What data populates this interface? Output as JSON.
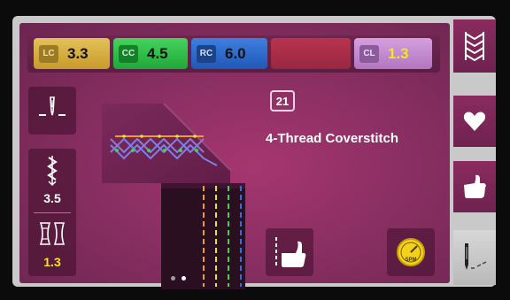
{
  "tension": {
    "lc": {
      "tag": "LC",
      "value": "3.3"
    },
    "cc": {
      "tag": "CC",
      "value": "4.5"
    },
    "rc": {
      "tag": "RC",
      "value": "6.0"
    },
    "cl": {
      "tag": "CL",
      "value": "1.3"
    }
  },
  "stitch": {
    "number": "21",
    "name": "4-Thread Coverstitch",
    "stitch_length": "3.5",
    "differential_feed": "1.3"
  },
  "action_buttons": {
    "spm_label": "SPM"
  },
  "colors": {
    "background_magenta": "#8a2f63",
    "lc_yellow": "#d4ad3e",
    "cc_green": "#2bbb45",
    "rc_blue": "#2b6ac9",
    "empty_red": "#a82d48",
    "cl_lilac": "#c28bd0",
    "highlight_yellow": "#f4e421",
    "thread_orange": "#f39b2a",
    "thread_yellow": "#e8e23a",
    "thread_green": "#3fd24e",
    "thread_blue": "#2f6fe6"
  },
  "icons": {
    "right_tabs": [
      "stitch-pattern-icon",
      "heart-icon",
      "hand-icon",
      "needle-icon"
    ],
    "side": [
      "needle-position-icon",
      "stitch-length-icon",
      "differential-feed-icon"
    ],
    "actions": [
      "thread-hand-icon",
      "spm-speed-icon"
    ]
  },
  "pagination": {
    "total": 2,
    "current": 2
  }
}
